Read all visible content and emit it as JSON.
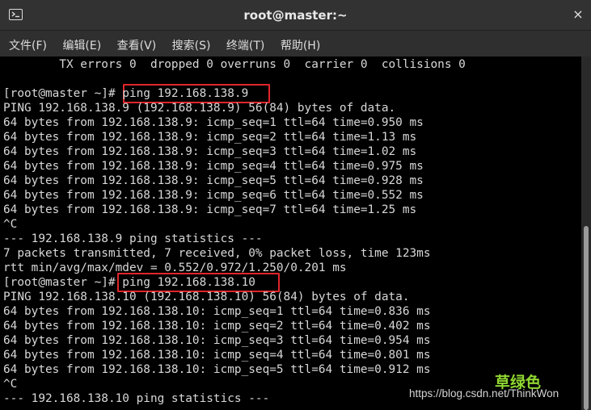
{
  "window": {
    "title": "root@master:~",
    "close_glyph": "×",
    "icon": "terminal-icon"
  },
  "menu": [
    {
      "label": "文件(F)"
    },
    {
      "label": "编辑(E)"
    },
    {
      "label": "查看(V)"
    },
    {
      "label": "搜索(S)"
    },
    {
      "label": "终端(T)"
    },
    {
      "label": "帮助(H)"
    }
  ],
  "terminal": {
    "lines": [
      "        TX errors 0  dropped 0 overruns 0  carrier 0  collisions 0",
      "",
      "[root@master ~]# ping 192.168.138.9",
      "PING 192.168.138.9 (192.168.138.9) 56(84) bytes of data.",
      "64 bytes from 192.168.138.9: icmp_seq=1 ttl=64 time=0.950 ms",
      "64 bytes from 192.168.138.9: icmp_seq=2 ttl=64 time=1.13 ms",
      "64 bytes from 192.168.138.9: icmp_seq=3 ttl=64 time=1.02 ms",
      "64 bytes from 192.168.138.9: icmp_seq=4 ttl=64 time=0.975 ms",
      "64 bytes from 192.168.138.9: icmp_seq=5 ttl=64 time=0.928 ms",
      "64 bytes from 192.168.138.9: icmp_seq=6 ttl=64 time=0.552 ms",
      "64 bytes from 192.168.138.9: icmp_seq=7 ttl=64 time=1.25 ms",
      "^C",
      "--- 192.168.138.9 ping statistics ---",
      "7 packets transmitted, 7 received, 0% packet loss, time 123ms",
      "rtt min/avg/max/mdev = 0.552/0.972/1.250/0.201 ms",
      "[root@master ~]# ping 192.168.138.10",
      "PING 192.168.138.10 (192.168.138.10) 56(84) bytes of data.",
      "64 bytes from 192.168.138.10: icmp_seq=1 ttl=64 time=0.836 ms",
      "64 bytes from 192.168.138.10: icmp_seq=2 ttl=64 time=0.402 ms",
      "64 bytes from 192.168.138.10: icmp_seq=3 ttl=64 time=0.954 ms",
      "64 bytes from 192.168.138.10: icmp_seq=4 ttl=64 time=0.801 ms",
      "64 bytes from 192.168.138.10: icmp_seq=5 ttl=64 time=0.912 ms",
      "^C",
      "--- 192.168.138.10 ping statistics ---"
    ],
    "highlight_color": "#e0252b"
  },
  "watermark": {
    "logo_text": "草绿色",
    "url": "https://blog.csdn.net/ThinkWon"
  },
  "colors": {
    "background": "#000000",
    "text": "#d8d8d8",
    "titlebar": "#323232",
    "watermark_logo": "#8fd631"
  }
}
